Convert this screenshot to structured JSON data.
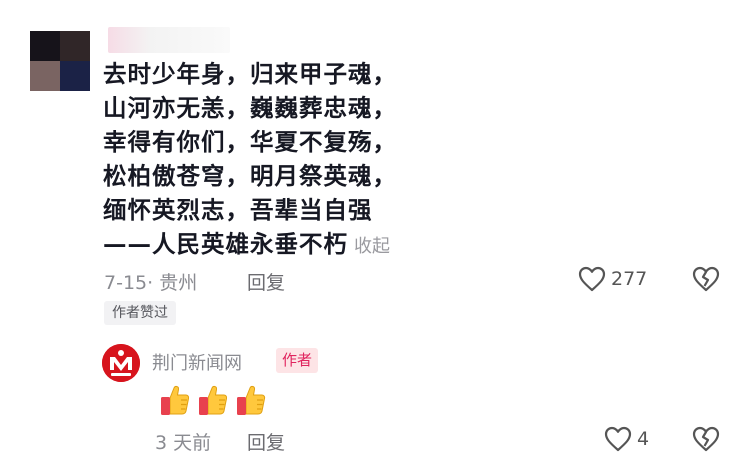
{
  "comment": {
    "lines": [
      "去时少年身，归来甲子魂，",
      "山河亦无恙，巍巍葬忠魂，",
      "幸得有你们，华夏不复殇，",
      "松柏傲苍穹，明月祭英魂，",
      "缅怀英烈志，吾辈当自强",
      "——人民英雄永垂不朽"
    ],
    "collapse_label": "收起",
    "date_location": "7-15· 贵州",
    "reply_label": "回复",
    "likes": "277",
    "author_liked_badge": "作者赞过"
  },
  "reply": {
    "author": "荆门新闻网",
    "author_badge": "作者",
    "emoji_content": "👍👍👍",
    "time": "3 天前",
    "reply_label": "回复",
    "likes": "4"
  },
  "icons": {
    "like": "heart-outline-icon",
    "dislike": "broken-heart-icon",
    "emoji": "thumbs-up-icon"
  },
  "colors": {
    "badge_pink": "#e0245e",
    "logo_red": "#d7141d",
    "gray_text": "#8a8b91"
  }
}
